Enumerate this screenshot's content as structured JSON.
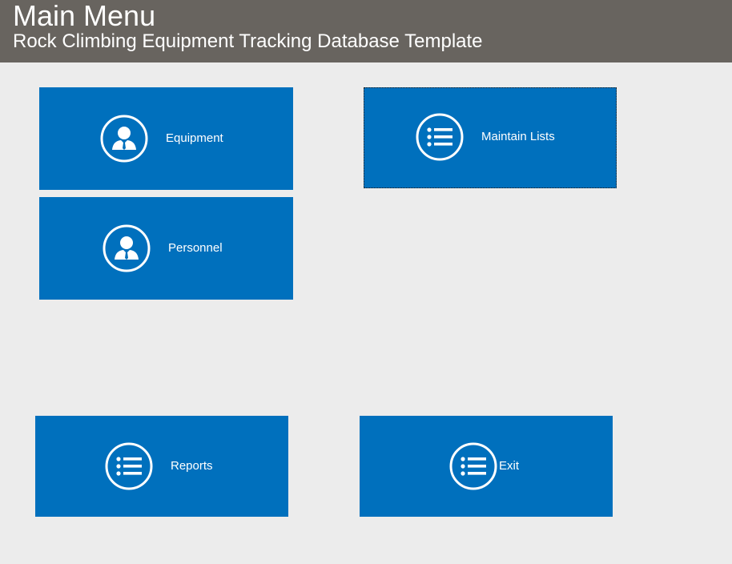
{
  "header": {
    "title": "Main Menu",
    "subtitle": "Rock Climbing Equipment Tracking Database Template"
  },
  "tiles": {
    "equipment": {
      "label": "Equipment",
      "icon": "person-icon"
    },
    "personnel": {
      "label": "Personnel",
      "icon": "person-icon"
    },
    "maintain_lists": {
      "label": "Maintain Lists",
      "icon": "list-icon"
    },
    "reports": {
      "label": "Reports",
      "icon": "list-icon"
    },
    "exit": {
      "label": "Exit",
      "icon": "list-icon"
    }
  },
  "colors": {
    "header_bg": "#68645f",
    "page_bg": "#ececec",
    "tile_bg": "#0070bd",
    "tile_text": "#ffffff"
  }
}
